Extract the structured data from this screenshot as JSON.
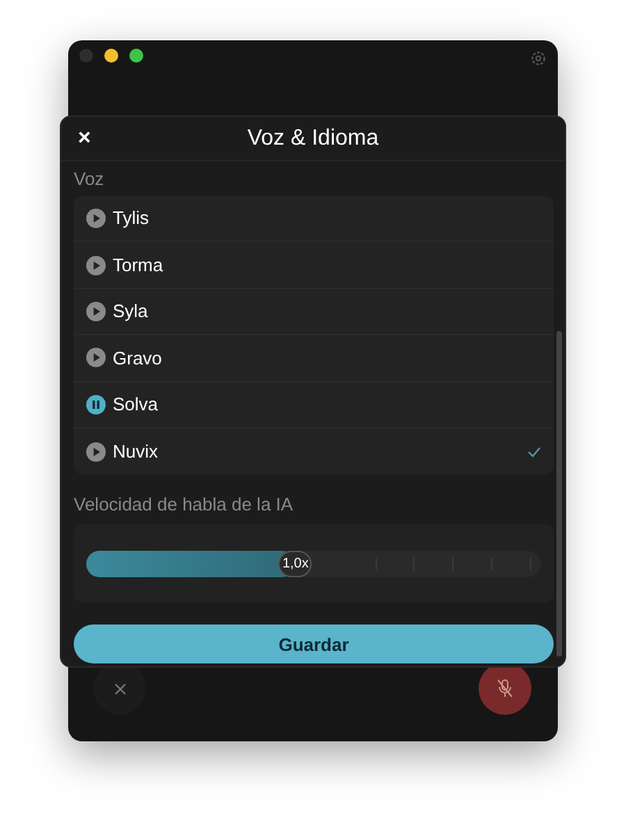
{
  "sheet": {
    "title": "Voz & Idioma",
    "close": "×"
  },
  "voice_section": {
    "label": "Voz"
  },
  "voices": [
    {
      "name": "Tylis",
      "playing": false,
      "selected": false
    },
    {
      "name": "Torma",
      "playing": false,
      "selected": false
    },
    {
      "name": "Syla",
      "playing": false,
      "selected": false
    },
    {
      "name": "Gravo",
      "playing": false,
      "selected": false
    },
    {
      "name": "Solva",
      "playing": true,
      "selected": false
    },
    {
      "name": "Nuvix",
      "playing": false,
      "selected": true
    }
  ],
  "speed": {
    "label": "Velocidad de habla de la IA",
    "level": 0.46,
    "reading": "1,0x"
  },
  "save_button": "Guardar"
}
